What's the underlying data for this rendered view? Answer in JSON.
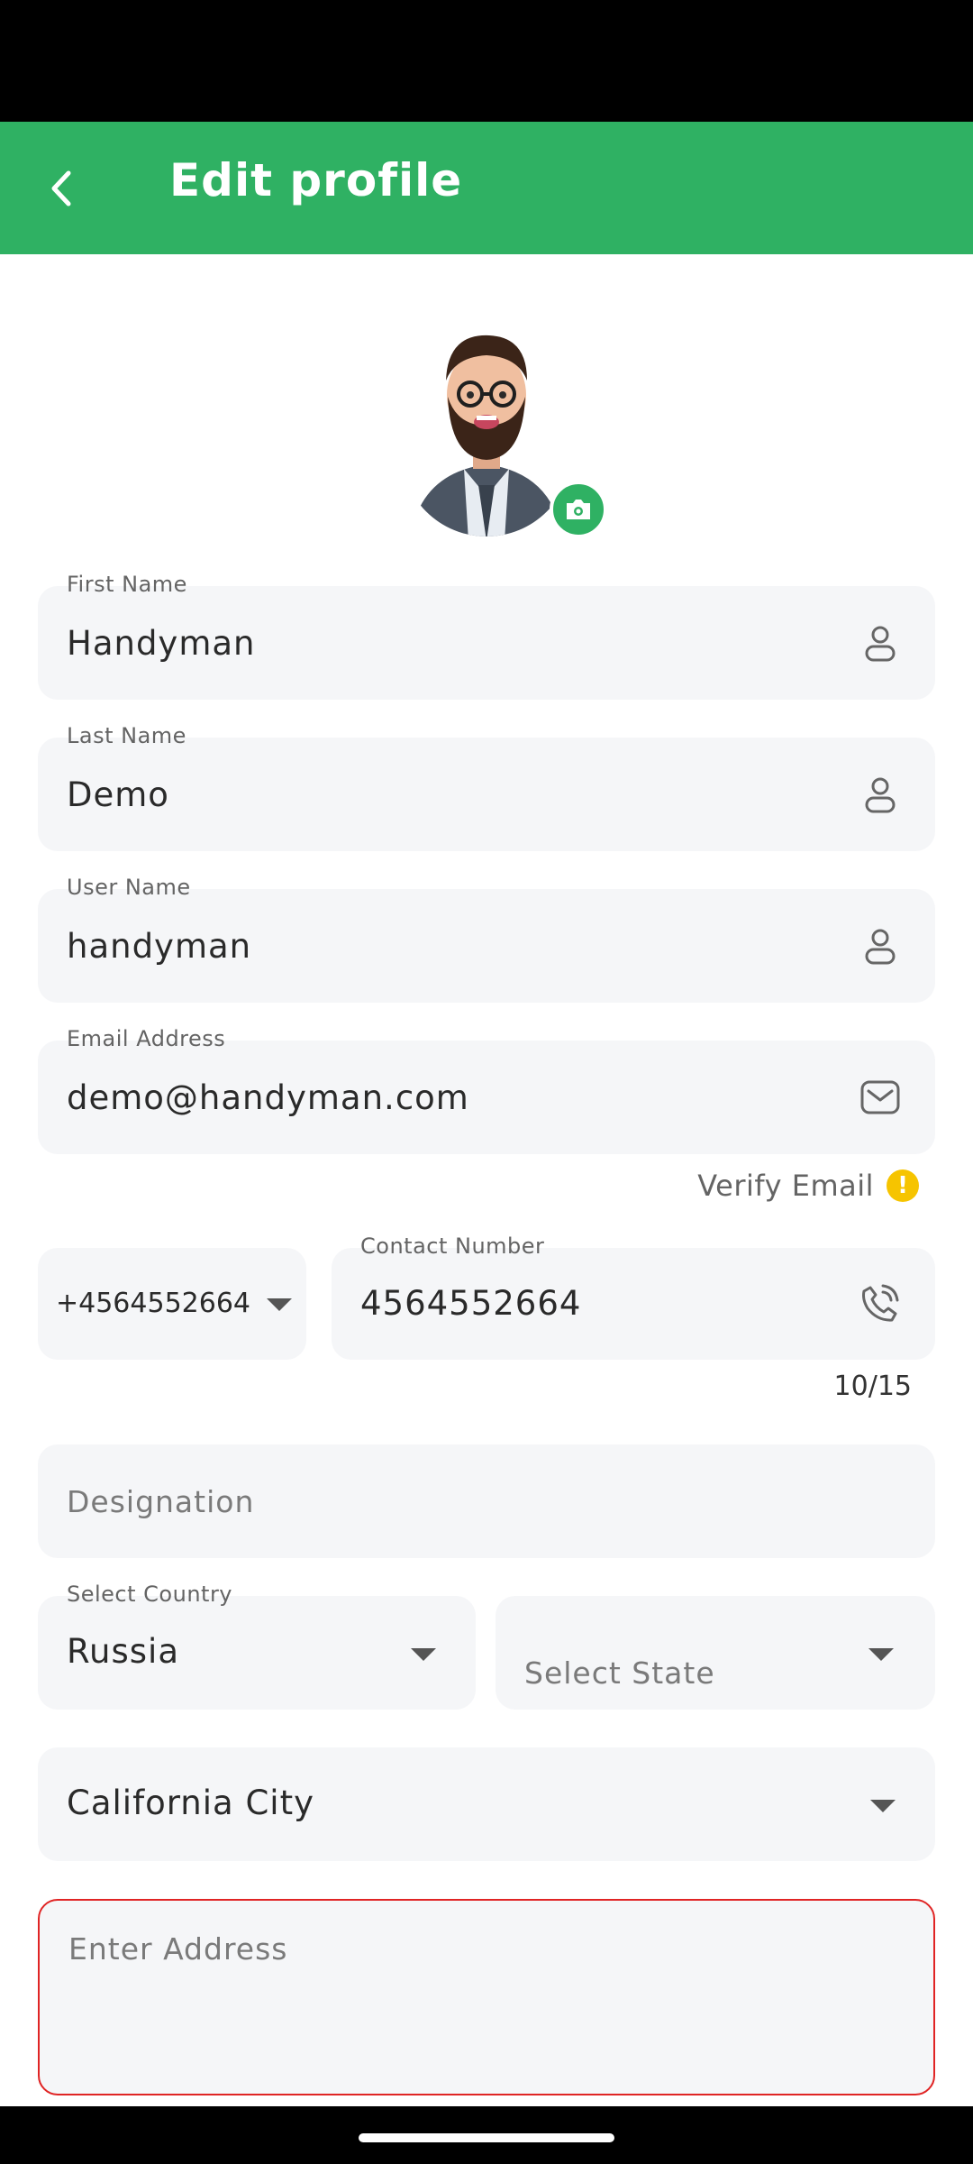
{
  "appbar": {
    "title": "Edit profile",
    "back_icon": "chevron-left-icon"
  },
  "profile": {
    "avatar": "user-avatar",
    "camera_icon": "camera-icon"
  },
  "form": {
    "first_name": {
      "label": "First Name",
      "value": "Handyman",
      "icon": "person-icon"
    },
    "last_name": {
      "label": "Last Name",
      "value": "Demo",
      "icon": "person-icon"
    },
    "user_name": {
      "label": "User Name",
      "value": "handyman",
      "icon": "person-icon"
    },
    "email": {
      "label": "Email Address",
      "value": "demo@handyman.com",
      "icon": "mail-icon"
    },
    "verify_email": {
      "label": "Verify Email",
      "icon": "warning-icon"
    },
    "country_code": {
      "value": "+4564552664"
    },
    "contact": {
      "label": "Contact Number",
      "value": "4564552664",
      "icon": "phone-icon",
      "counter": "10/15"
    },
    "designation": {
      "placeholder": "Designation"
    },
    "country": {
      "label": "Select Country",
      "value": "Russia"
    },
    "state": {
      "placeholder": "Select State"
    },
    "city": {
      "value": "California City"
    },
    "address": {
      "placeholder": "Enter Address"
    }
  },
  "colors": {
    "primary": "#2fb163",
    "field_bg": "#f5f6f8",
    "error": "#e02424",
    "warning": "#f6c400"
  }
}
